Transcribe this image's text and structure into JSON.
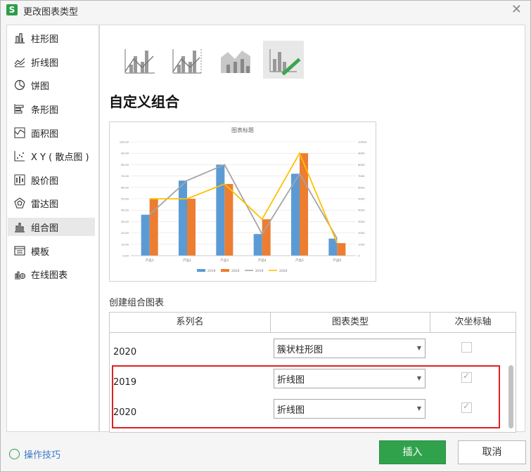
{
  "dialog": {
    "title": "更改图表类型",
    "app_icon": "S"
  },
  "sidebar": {
    "items": [
      {
        "label": "柱形图",
        "icon": "column-chart-icon"
      },
      {
        "label": "折线图",
        "icon": "line-chart-icon"
      },
      {
        "label": "饼图",
        "icon": "pie-chart-icon"
      },
      {
        "label": "条形图",
        "icon": "bar-chart-icon"
      },
      {
        "label": "面积图",
        "icon": "area-chart-icon"
      },
      {
        "label": "X Y ( 散点图 )",
        "icon": "scatter-chart-icon"
      },
      {
        "label": "股价图",
        "icon": "stock-chart-icon"
      },
      {
        "label": "雷达图",
        "icon": "radar-chart-icon"
      },
      {
        "label": "组合图",
        "icon": "combo-chart-icon",
        "selected": true
      },
      {
        "label": "模板",
        "icon": "template-icon"
      },
      {
        "label": "在线图表",
        "icon": "online-chart-icon"
      }
    ]
  },
  "main": {
    "section_title": "自定义组合",
    "combo_label": "创建组合图表",
    "table": {
      "headers": [
        "系列名",
        "图表类型",
        "次坐标轴"
      ],
      "rows": [
        {
          "name": "2020",
          "type": "簇状柱形图",
          "secondary": false
        },
        {
          "name": "2019",
          "type": "折线图",
          "secondary": true
        },
        {
          "name": "2020",
          "type": "折线图",
          "secondary": true
        }
      ]
    }
  },
  "footer": {
    "tips": "操作技巧",
    "insert": "插入",
    "cancel": "取消"
  },
  "colors": {
    "bar_2019": "#5b9bd5",
    "bar_2020": "#ed7d31",
    "line_2019": "#a5a5a5",
    "line_2020": "#ffc000",
    "accent": "#31a24c"
  },
  "chart_data": {
    "type": "bar",
    "title": "图表标题",
    "categories": [
      "产品1",
      "产品2",
      "产品3",
      "产品4",
      "产品5",
      "产品6"
    ],
    "series": [
      {
        "name": "2019",
        "kind": "bar",
        "axis": "primary",
        "values": [
          36,
          66,
          80,
          19,
          72,
          15
        ]
      },
      {
        "name": "2020",
        "kind": "bar",
        "axis": "primary",
        "values": [
          50,
          50,
          63,
          32,
          90,
          11
        ]
      },
      {
        "name": "2019",
        "kind": "line",
        "axis": "secondary",
        "values": [
          3600,
          6600,
          8000,
          1900,
          7200,
          1500
        ]
      },
      {
        "name": "2020",
        "kind": "line",
        "axis": "secondary",
        "values": [
          5000,
          5000,
          6300,
          3200,
          9000,
          1100
        ]
      }
    ],
    "ylim": [
      0,
      100
    ],
    "y_ticks": [
      "0.00",
      "10.00",
      "20.00",
      "30.00",
      "40.00",
      "50.00",
      "60.00",
      "70.00",
      "80.00",
      "90.00",
      "100.00"
    ],
    "y2lim": [
      0,
      10000
    ],
    "y2_ticks": [
      "0",
      "1000",
      "2000",
      "3000",
      "4000",
      "5000",
      "6000",
      "7000",
      "8000",
      "9000",
      "10000"
    ],
    "legend": "bottom",
    "grid": true
  }
}
